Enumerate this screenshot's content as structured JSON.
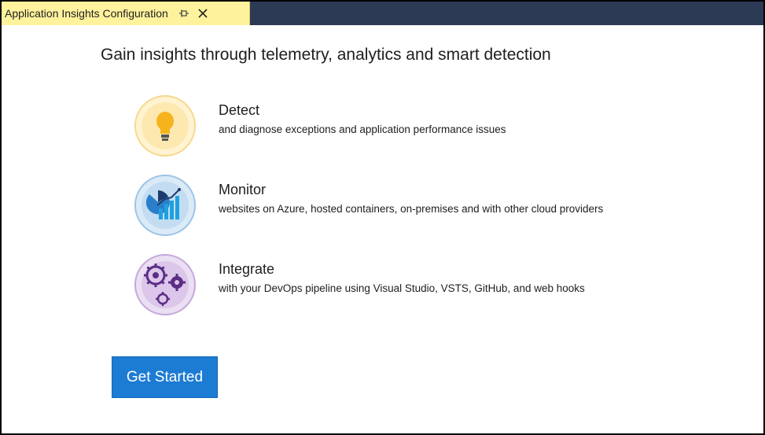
{
  "tab": {
    "label": "Application Insights Configuration",
    "pin_icon": "pin-icon",
    "close_icon": "close-icon"
  },
  "headline": "Gain insights through telemetry, analytics and smart detection",
  "features": [
    {
      "icon": "lightbulb-icon",
      "title": "Detect",
      "description": "and diagnose exceptions and application performance issues",
      "icon_color": "#f7cf5d"
    },
    {
      "icon": "chart-icon",
      "title": "Monitor",
      "description": "websites on Azure, hosted containers, on-premises and with other cloud providers",
      "icon_color": "#1f8fd6"
    },
    {
      "icon": "gears-icon",
      "title": "Integrate",
      "description": "with your DevOps pipeline using Visual Studio, VSTS, GitHub, and web hooks",
      "icon_color": "#6c3f99"
    }
  ],
  "button": {
    "label": "Get Started",
    "color": "#1c7bd3"
  },
  "colors": {
    "tab_active_bg": "#fff29d",
    "tabbar_bg": "#2d3a55"
  }
}
